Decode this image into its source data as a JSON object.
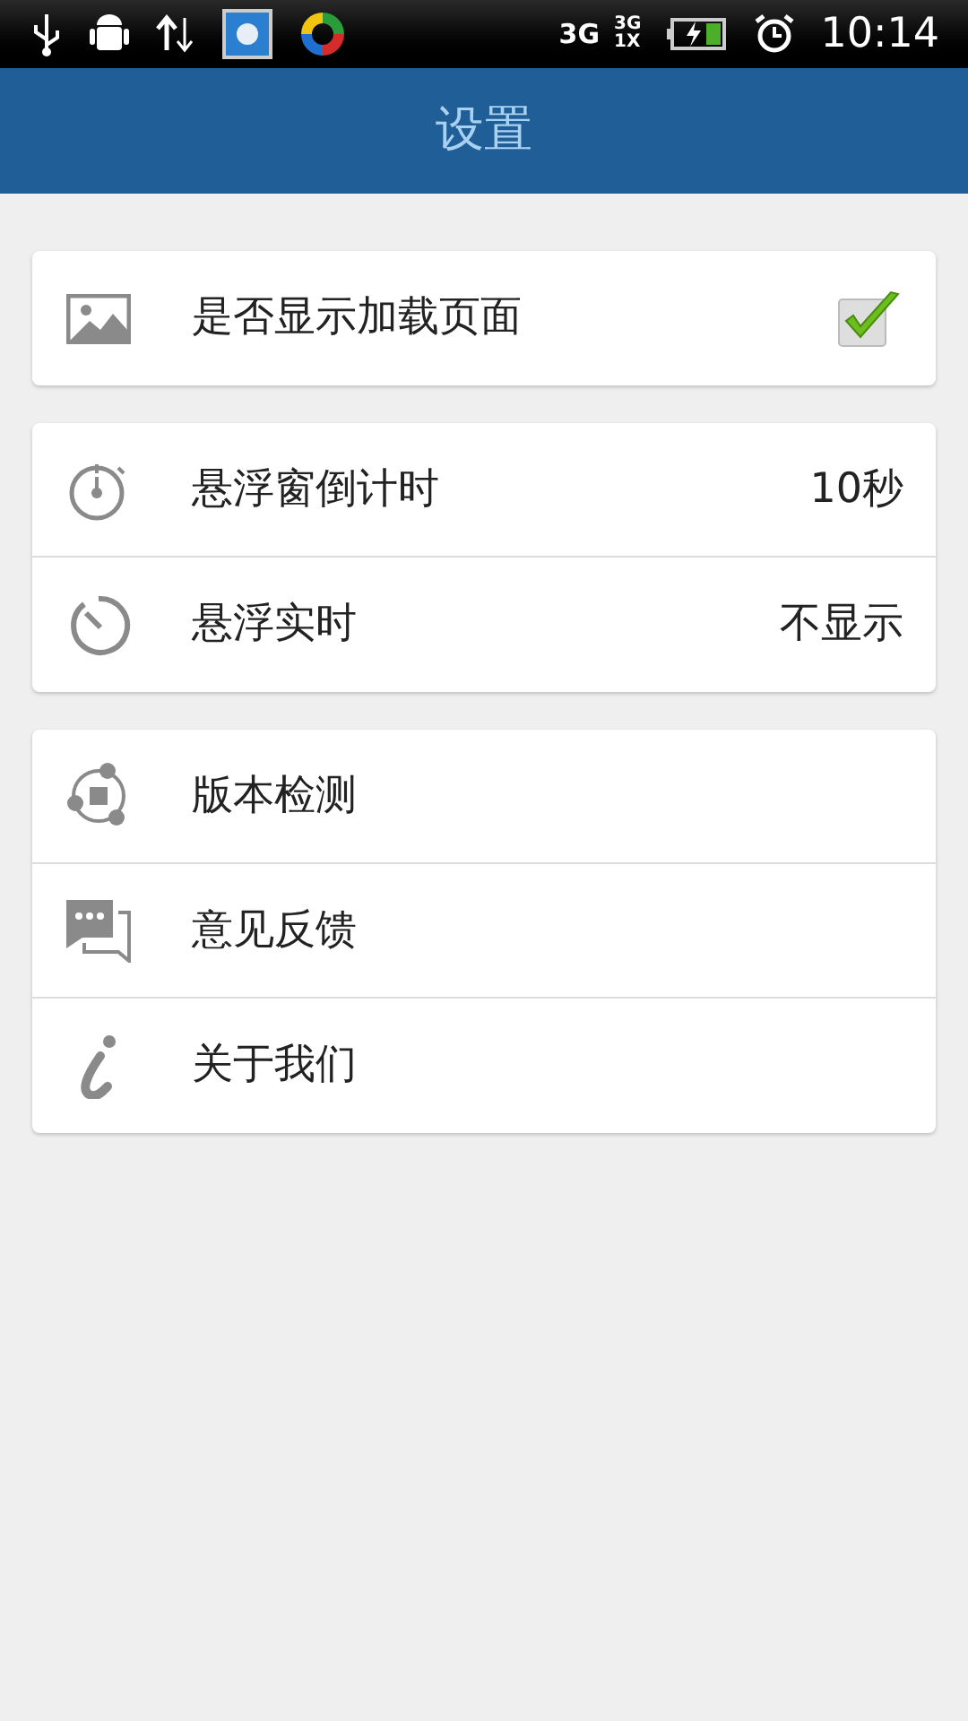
{
  "status_bar": {
    "network": "3G",
    "signal_labels": [
      "3G",
      "1X"
    ],
    "time": "10:14"
  },
  "header": {
    "title": "设置"
  },
  "groups": [
    {
      "items": [
        {
          "label": "是否显示加载页面",
          "kind": "checkbox",
          "checked": true
        }
      ]
    },
    {
      "items": [
        {
          "label": "悬浮窗倒计时",
          "kind": "value",
          "value": "10秒"
        },
        {
          "label": "悬浮实时",
          "kind": "value",
          "value": "不显示"
        }
      ]
    },
    {
      "items": [
        {
          "label": "版本检测",
          "kind": "link"
        },
        {
          "label": "意见反馈",
          "kind": "link"
        },
        {
          "label": "关于我们",
          "kind": "link"
        }
      ]
    }
  ]
}
